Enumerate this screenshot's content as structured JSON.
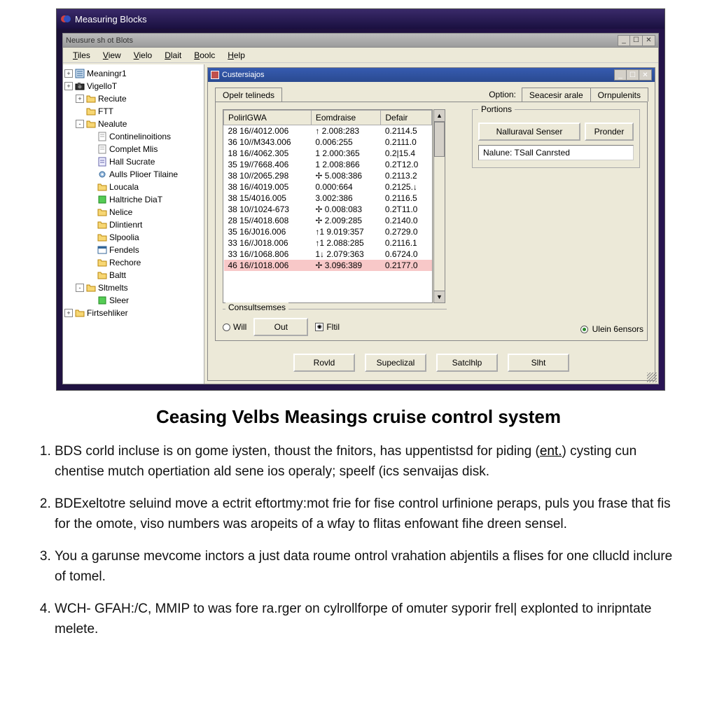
{
  "outer_window": {
    "title": "Measuring Blocks"
  },
  "inner_window": {
    "title": "Neusure sh ot Blots"
  },
  "menubar": [
    "Tiles",
    "View",
    "Vielo",
    "Dlait",
    "Boolc",
    "Help"
  ],
  "tree": [
    {
      "depth": 0,
      "toggle": "+",
      "icon": "list",
      "label": "Meaningr1"
    },
    {
      "depth": 0,
      "toggle": "+",
      "icon": "camera",
      "label": "VigelloT"
    },
    {
      "depth": 1,
      "toggle": "+",
      "icon": "folder",
      "label": "Reciute"
    },
    {
      "depth": 1,
      "toggle": "",
      "icon": "folder",
      "label": "FTT"
    },
    {
      "depth": 1,
      "toggle": "-",
      "icon": "folder",
      "label": "Nealute"
    },
    {
      "depth": 2,
      "toggle": "",
      "icon": "doc",
      "label": "Continelinoitions"
    },
    {
      "depth": 2,
      "toggle": "",
      "icon": "doc",
      "label": "Complet Mlis"
    },
    {
      "depth": 2,
      "toggle": "",
      "icon": "sheet",
      "label": "Hall Sucrate"
    },
    {
      "depth": 2,
      "toggle": "",
      "icon": "gear",
      "label": "Aulls Plioer Tilaine"
    },
    {
      "depth": 2,
      "toggle": "",
      "icon": "folder",
      "label": "Loucala"
    },
    {
      "depth": 2,
      "toggle": "",
      "icon": "green",
      "label": "Haltriche DiaT"
    },
    {
      "depth": 2,
      "toggle": "",
      "icon": "folder",
      "label": "Nelice"
    },
    {
      "depth": 2,
      "toggle": "",
      "icon": "folder",
      "label": "Dlintienrt"
    },
    {
      "depth": 2,
      "toggle": "",
      "icon": "folder",
      "label": "Slpoolia"
    },
    {
      "depth": 2,
      "toggle": "",
      "icon": "app",
      "label": "Fendels"
    },
    {
      "depth": 2,
      "toggle": "",
      "icon": "folder",
      "label": "Rechore"
    },
    {
      "depth": 2,
      "toggle": "",
      "icon": "folder",
      "label": "Baltt"
    },
    {
      "depth": 1,
      "toggle": "-",
      "icon": "folder",
      "label": "Sltmelts"
    },
    {
      "depth": 2,
      "toggle": "",
      "icon": "green",
      "label": "Sleer"
    },
    {
      "depth": 0,
      "toggle": "+",
      "icon": "folder",
      "label": "Firtsehliker"
    }
  ],
  "child_window": {
    "title": "Custersiajos"
  },
  "tabs_left": [
    "Opelr telineds"
  ],
  "option_label": "Option:",
  "tabs_right": [
    "Seacesir arale",
    "Ornpulenits"
  ],
  "table": {
    "headers": [
      "PolirlGWA",
      "Eomdraise",
      "Defair"
    ],
    "rows": [
      {
        "c": [
          "28 16//4012.006",
          "↑  2.008:283",
          "0.2114.5"
        ],
        "hl": false
      },
      {
        "c": [
          "36 10//M343.006",
          "   0.006:255",
          "0.2111.0"
        ],
        "hl": false
      },
      {
        "c": [
          "18 16//4062.305",
          "1  2.000:365",
          "0.2|15.4"
        ],
        "hl": false
      },
      {
        "c": [
          "35 19//7668.406",
          "1  2.008:866",
          "0.2T12.0"
        ],
        "hl": false
      },
      {
        "c": [
          "38 10//2065.298",
          "✢ 5.008:386",
          "0.2113.2"
        ],
        "hl": false
      },
      {
        "c": [
          "38 16//4019.005",
          "   0.000:664",
          "0.2125.↓"
        ],
        "hl": false
      },
      {
        "c": [
          "38 15/4016.005",
          "   3.002:386",
          "0.2116.5"
        ],
        "hl": false
      },
      {
        "c": [
          "38 10//1024-673",
          "✢ 0.008:083",
          "0.2T11.0"
        ],
        "hl": false
      },
      {
        "c": [
          "28 15//4018.608",
          "✢ 2.009:285",
          "0.2140.0"
        ],
        "hl": false
      },
      {
        "c": [
          "35 16/J016.006",
          "↑1 9.019:357",
          "0.2729.0"
        ],
        "hl": false
      },
      {
        "c": [
          "33 16//J018.006",
          "↑1 2.088:285",
          "0.2116.1"
        ],
        "hl": false
      },
      {
        "c": [
          "33 16//1068.806",
          "1↓ 2.079:363",
          "0.6724.0"
        ],
        "hl": false
      },
      {
        "c": [
          "46 16//1018.006",
          "✢ 3.096:389",
          "0.2177.0"
        ],
        "hl": true
      }
    ]
  },
  "portions": {
    "legend": "Portions",
    "btn1": "Nalluraval Senser",
    "btn2": "Pronder",
    "field_label": "Nalune:",
    "field_value": "TSall Canrsted"
  },
  "consult": {
    "legend": "Consultsemses",
    "radio_will": "Will",
    "btn_out": "Out",
    "check_fitl_checked": true,
    "check_fitl": "Fltil"
  },
  "ulein_label": "Ulein 6ensors",
  "buttons": [
    "Rovld",
    "Supeclizal",
    "Satclhlp",
    "Slht"
  ],
  "doc": {
    "heading": "Ceasing Velbs Measings cruise control system",
    "items": [
      "BDS corld incluse is on gome iysten, thoust the fnitors, has uppentistsd for piding (ent.) cysting cun chentise mutch opertiation ald sene ios operaly; speelf (ics senvaijas disk.",
      "BDExeltotre seluind move a ectrit eftortmy:mot frie for fise control urfinione peraps, puls you frase that fis for the omote, viso numbers was aropeits of a wfay to flitas enfowant fihe dreen sensel.",
      "You a garunse mevcome inctors a just data roume ontrol vrahation abjentils a flises for one cllucld inclure of tomel.",
      "WCH- GFAH:/C, MMIP to was fore ra.rger on cylrollforpe of omuter syporir frel| explonted to inripntate melete."
    ]
  }
}
